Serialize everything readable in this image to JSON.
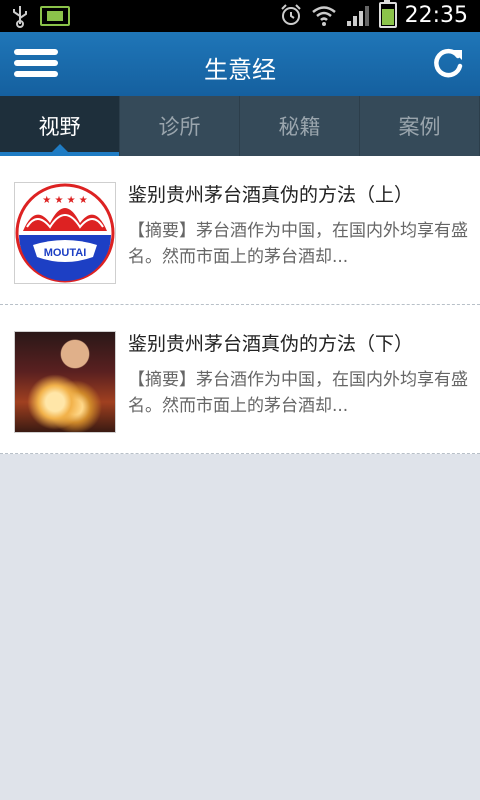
{
  "status_bar": {
    "time": "22:35"
  },
  "header": {
    "title": "生意经"
  },
  "tabs": [
    {
      "label": "视野",
      "active": true
    },
    {
      "label": "诊所",
      "active": false
    },
    {
      "label": "秘籍",
      "active": false
    },
    {
      "label": "案例",
      "active": false
    }
  ],
  "articles": [
    {
      "title": "鉴别贵州茅台酒真伪的方法（上）",
      "summary": "【摘要】茅台酒作为中国，在国内外均享有盛名。然而市面上的茅台酒却...",
      "thumb_text": "MOUTAI"
    },
    {
      "title": "鉴别贵州茅台酒真伪的方法（下）",
      "summary": "【摘要】茅台酒作为中国，在国内外均享有盛名。然而市面上的茅台酒却..."
    }
  ],
  "colors": {
    "header": "#1a6aab",
    "tab_bar": "#354a59",
    "tab_active": "#1e2f3b",
    "accent": "#1f7cc4",
    "background": "#dfe3ea"
  }
}
